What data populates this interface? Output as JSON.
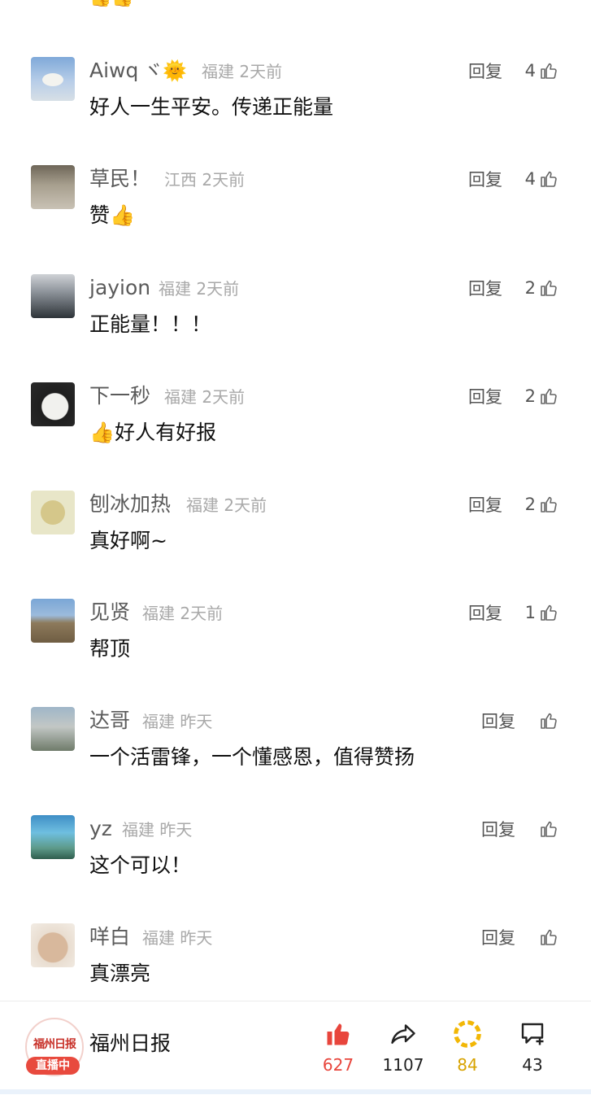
{
  "top_partial_emoji": "👍👍",
  "comments": [
    {
      "username": "Aiwq",
      "badges": "ヾ🌞",
      "region": "福建",
      "time": "2天前",
      "reply": "回复",
      "likes": "4",
      "text": "好人一生平安。传递正能量"
    },
    {
      "username": "草民！",
      "badges": "",
      "region": "江西",
      "time": "2天前",
      "reply": "回复",
      "likes": "4",
      "text": "赞👍"
    },
    {
      "username": "jayion",
      "badges": "",
      "region": "福建",
      "time": "2天前",
      "reply": "回复",
      "likes": "2",
      "text": "正能量！！！"
    },
    {
      "username": "下一秒",
      "badges": "",
      "region": "福建",
      "time": "2天前",
      "reply": "回复",
      "likes": "2",
      "text": "👍好人有好报"
    },
    {
      "username": "刨冰加热",
      "badges": "",
      "region": "福建",
      "time": "2天前",
      "reply": "回复",
      "likes": "2",
      "text": "真好啊~"
    },
    {
      "username": "见贤",
      "badges": "",
      "region": "福建",
      "time": "2天前",
      "reply": "回复",
      "likes": "1",
      "text": "帮顶"
    },
    {
      "username": "达哥",
      "badges": "",
      "region": "福建",
      "time": "昨天",
      "reply": "回复",
      "likes": "",
      "text": "一个活雷锋，一个懂感恩，值得赞扬"
    },
    {
      "username": "yz",
      "badges": "",
      "region": "福建",
      "time": "昨天",
      "reply": "回复",
      "likes": "",
      "text": "这个可以！"
    },
    {
      "username": "咩白",
      "badges": "",
      "region": "福建",
      "time": "昨天",
      "reply": "回复",
      "likes": "",
      "text": "真漂亮"
    }
  ],
  "bottom_bar": {
    "logo_text": "福州日报",
    "live_badge": "直播中",
    "brand_name": "福州日报",
    "like_count": "627",
    "share_count": "1107",
    "favorite_count": "84",
    "comment_count": "43",
    "colors": {
      "like": "#e8453c",
      "favorite": "#f2b705",
      "live": "#e84a3e"
    }
  }
}
